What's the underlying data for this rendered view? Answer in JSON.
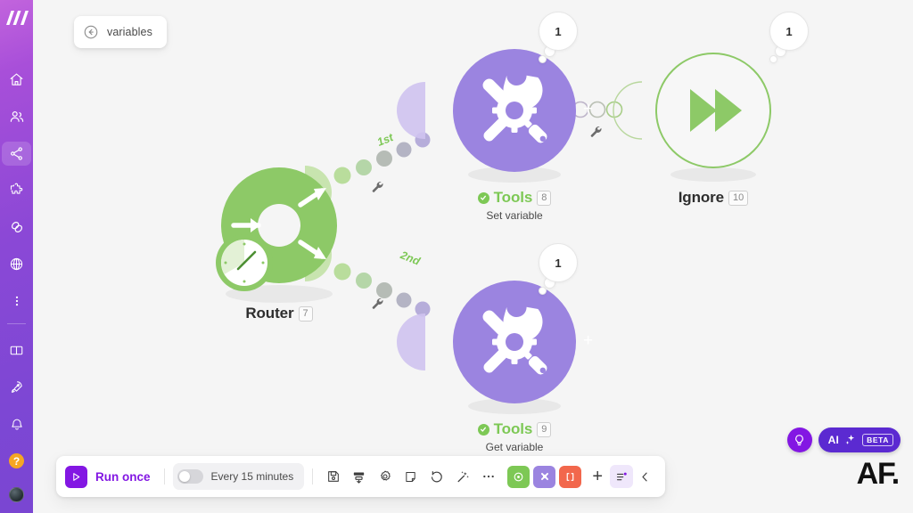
{
  "app": {
    "logo": "make-logo",
    "background": "#f5f5f5",
    "accent_purple": "#8317e3",
    "accent_green": "#7dc855",
    "node_purple": "#9b84e0"
  },
  "sidebar": {
    "items": [
      {
        "name": "home",
        "icon": "home-icon",
        "active": false
      },
      {
        "name": "organization",
        "icon": "users-icon",
        "active": false
      },
      {
        "name": "scenarios",
        "icon": "share-nodes-icon",
        "active": true
      },
      {
        "name": "templates",
        "icon": "puzzle-icon",
        "active": false
      },
      {
        "name": "connections",
        "icon": "link-icon",
        "active": false
      },
      {
        "name": "webhooks",
        "icon": "globe-icon",
        "active": false
      },
      {
        "name": "more",
        "icon": "dots-vertical-icon",
        "active": false
      }
    ],
    "bottom_items": [
      {
        "name": "documentation",
        "icon": "book-icon"
      },
      {
        "name": "whats-new",
        "icon": "rocket-icon"
      },
      {
        "name": "notifications",
        "icon": "bell-icon"
      },
      {
        "name": "help",
        "icon": "question-icon",
        "label": "?"
      },
      {
        "name": "profile",
        "icon": "avatar-icon"
      }
    ]
  },
  "breadcrumb": {
    "back_icon": "arrow-left-circle-icon",
    "label": "variables"
  },
  "canvas": {
    "nodes": [
      {
        "id": "router",
        "name": "Router",
        "badge": "7",
        "subtitle": "",
        "icon": "router-icon",
        "color": "#8dc967",
        "status": "none",
        "bubble": ""
      },
      {
        "id": "tools-top",
        "name": "Tools",
        "badge": "8",
        "subtitle": "Set variable",
        "icon": "tools-icon",
        "color": "#9b84e0",
        "status": "ok",
        "bubble": "1"
      },
      {
        "id": "tools-bottom",
        "name": "Tools",
        "badge": "9",
        "subtitle": "Get variable",
        "icon": "tools-icon",
        "color": "#9b84e0",
        "status": "ok",
        "bubble": "1"
      },
      {
        "id": "ignore",
        "name": "Ignore",
        "badge": "10",
        "subtitle": "",
        "icon": "fast-forward-icon",
        "color": "#8dc967",
        "status": "none",
        "bubble": "1"
      }
    ],
    "route_labels": [
      "1st",
      "2nd"
    ],
    "connector_icon": "wrench-icon",
    "add_module_icon": "plus-icon"
  },
  "toolbar": {
    "run_label": "Run once",
    "run_icon": "play-icon",
    "schedule": {
      "enabled": false,
      "label": "Every 15 minutes"
    },
    "icons": [
      {
        "name": "save-icon",
        "label": "save"
      },
      {
        "name": "align-icon",
        "label": "auto-align"
      },
      {
        "name": "settings-gear-icon",
        "label": "settings"
      },
      {
        "name": "notes-icon",
        "label": "notes"
      },
      {
        "name": "undo-icon",
        "label": "undo"
      },
      {
        "name": "magic-wand-icon",
        "label": "explain-flow"
      },
      {
        "name": "more-horizontal-icon",
        "label": "more"
      }
    ],
    "color_buttons": [
      {
        "name": "module-green-button",
        "color": "#7dc855",
        "icon": "circle-dot-icon"
      },
      {
        "name": "module-purple-button",
        "color": "#9b84e0",
        "icon": "tools-small-icon"
      },
      {
        "name": "module-red-button",
        "color": "#f2674c",
        "icon": "brackets-icon"
      }
    ],
    "plus_label": "+",
    "list_icon": "list-settings-icon",
    "collapse_icon": "chevron-left-icon"
  },
  "ai_assistant": {
    "bulb_icon": "lightbulb-icon",
    "label": "AI",
    "sparkle_icon": "sparkle-icon",
    "badge": "BETA"
  },
  "watermark": {
    "text": "AF."
  }
}
